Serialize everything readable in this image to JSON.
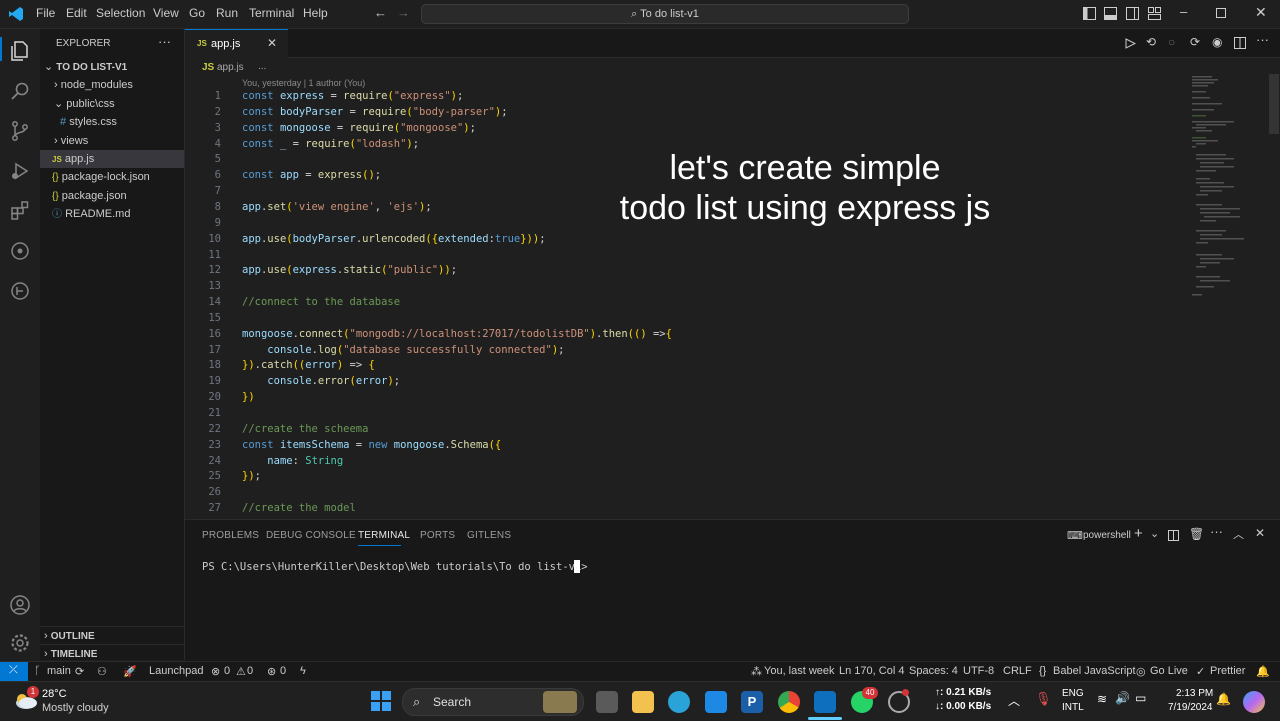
{
  "menu": [
    "File",
    "Edit",
    "Selection",
    "View",
    "Go",
    "Run",
    "Terminal",
    "Help"
  ],
  "command_center": "To do list-v1",
  "explorer": {
    "header": "EXPLORER",
    "project": "TO DO LIST-V1",
    "items": [
      "node_modules",
      "public\\css",
      "styles.css",
      "views",
      "app.js",
      "package-lock.json",
      "package.json",
      "README.md"
    ],
    "outline": "OUTLINE",
    "timeline": "TIMELINE"
  },
  "tab": {
    "icon": "JS",
    "label": "app.js"
  },
  "breadcrumb": "app.js",
  "breadcrumb_more": "...",
  "codelens": "You, yesterday | 1 author (You)",
  "code_lines": [
    {
      "n": "1",
      "t": "const express = require(\"express\");"
    },
    {
      "n": "2",
      "t": "const bodyParser = require(\"body-parser\");"
    },
    {
      "n": "3",
      "t": "const mongoose = require(\"mongoose\");"
    },
    {
      "n": "4",
      "t": "const _ = require(\"lodash\");"
    },
    {
      "n": "5",
      "t": ""
    },
    {
      "n": "6",
      "t": "const app = express();"
    },
    {
      "n": "7",
      "t": ""
    },
    {
      "n": "8",
      "t": "app.set('view engine', 'ejs');"
    },
    {
      "n": "9",
      "t": ""
    },
    {
      "n": "10",
      "t": "app.use(bodyParser.urlencoded({extended:true}));"
    },
    {
      "n": "11",
      "t": ""
    },
    {
      "n": "12",
      "t": "app.use(express.static(\"public\"));"
    },
    {
      "n": "13",
      "t": ""
    },
    {
      "n": "14",
      "t": "//connect to the database"
    },
    {
      "n": "15",
      "t": ""
    },
    {
      "n": "16",
      "t": "mongoose.connect(\"mongodb://localhost:27017/todolistDB\").then(() =>{"
    },
    {
      "n": "17",
      "t": "    console.log(\"database successfully connected\");"
    },
    {
      "n": "18",
      "t": "}).catch((error) => {"
    },
    {
      "n": "19",
      "t": "    console.error(error);"
    },
    {
      "n": "20",
      "t": "})"
    },
    {
      "n": "21",
      "t": ""
    },
    {
      "n": "22",
      "t": "//create the scheema"
    },
    {
      "n": "23",
      "t": "const itemsSchema = new mongoose.Schema({"
    },
    {
      "n": "24",
      "t": "    name: String"
    },
    {
      "n": "25",
      "t": "});"
    },
    {
      "n": "26",
      "t": ""
    },
    {
      "n": "27",
      "t": "//create the model"
    }
  ],
  "overlay_text": [
    "let's create simple",
    "todo list using express js"
  ],
  "panel": {
    "tabs": [
      "PROBLEMS",
      "DEBUG CONSOLE",
      "TERMINAL",
      "PORTS",
      "GITLENS"
    ],
    "active_tab": "TERMINAL",
    "shell": "powershell",
    "prompt": "PS C:\\Users\\HunterKiller\\Desktop\\Web tutorials\\To do list-v1>"
  },
  "status": {
    "branch": "main",
    "launchpad": "Launchpad",
    "errors": "0",
    "warnings": "0",
    "ports": "0",
    "blame": "You, last week",
    "position": "Ln 170, Col 4",
    "spaces": "Spaces: 4",
    "encoding": "UTF-8",
    "eol": "CRLF",
    "language": "Babel JavaScript",
    "golive": "Go Live",
    "prettier": "Prettier"
  },
  "taskbar": {
    "weather_temp": "28°C",
    "weather_desc": "Mostly cloudy",
    "weather_badge": "1",
    "search": "Search",
    "whatsapp_badge": "40",
    "net_up": "↑: 0.21 KB/s",
    "net_down": "↓: 0.00 KB/s",
    "lang1": "ENG",
    "lang2": "INTL",
    "time": "2:13 PM",
    "date": "7/19/2024"
  },
  "colors": {
    "accent": "#0078d4",
    "bg": "#1f1f1f",
    "sidebar": "#181818"
  }
}
